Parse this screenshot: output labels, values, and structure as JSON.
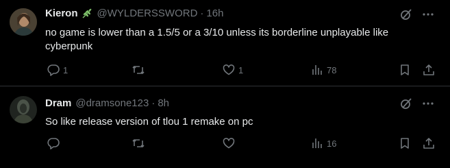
{
  "colors": {
    "background": "#000000",
    "text_primary": "#e7e9ea",
    "text_secondary": "#71767b",
    "divider": "#2f3336",
    "badge_green": "#7ec06a"
  },
  "tweets": [
    {
      "author_name": "Kieron",
      "badge_icon": "leaf-emoji-icon",
      "handle": "@WYLDERSSWORD",
      "separator": "·",
      "time": "16h",
      "text": "no game is lower than a 1.5/5 or a 3/10 unless its borderline unplayable like cyberpunk",
      "actions": {
        "reply_count": "1",
        "retweet_count": "",
        "like_count": "1",
        "views_count": "78"
      }
    },
    {
      "author_name": "Dram",
      "handle": "@dramsone123",
      "separator": "·",
      "time": "8h",
      "text": "So like release version of tlou 1 remake on pc",
      "actions": {
        "reply_count": "",
        "retweet_count": "",
        "like_count": "",
        "views_count": "16"
      }
    }
  ],
  "icons": {
    "grok": "grok-icon",
    "more": "more-icon",
    "reply": "reply-icon",
    "retweet": "retweet-icon",
    "like": "like-icon",
    "views": "views-icon",
    "bookmark": "bookmark-icon",
    "share": "share-icon"
  }
}
